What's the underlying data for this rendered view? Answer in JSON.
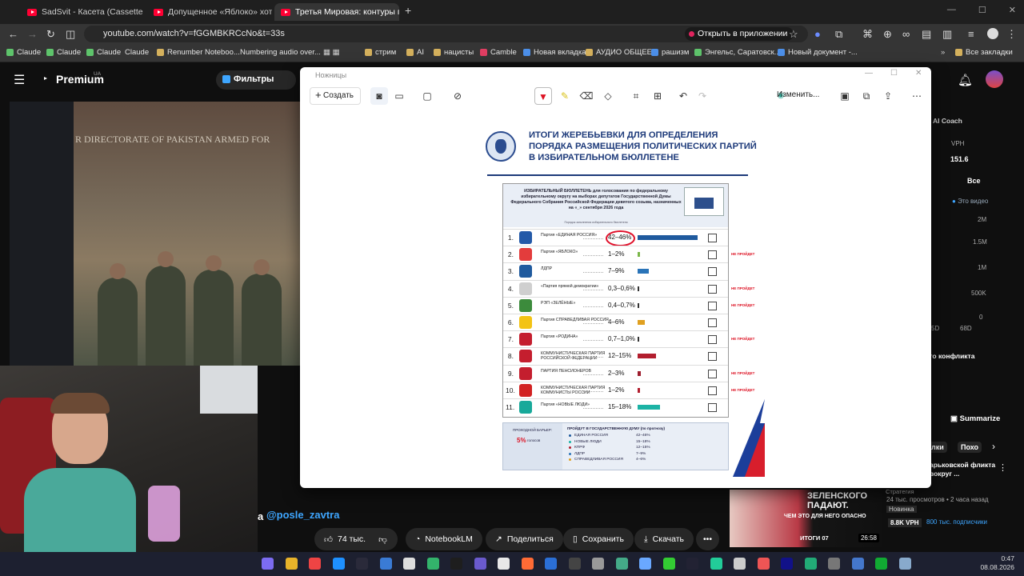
{
  "browser": {
    "tabs": [
      {
        "title": "SadSvit - Касета (Cassette 2021"
      },
      {
        "title": "Допущенное «Яблоко» хотят"
      },
      {
        "title": "Третья Мировая: контуры гло"
      }
    ],
    "new_tab": "+",
    "url": "youtube.com/watch?v=fGGMBKRCcNo&t=33s",
    "open_in_app": "Открыть в приложении",
    "bookmarks": [
      "Claude",
      "Claude",
      "Claude",
      "Claude",
      "Renumber Noteboo...",
      "Numbering audio over...",
      "стрим",
      "AI",
      "нацисты",
      "Camble",
      "Новая вкладка",
      "АУДИО ОБЩЕЕ",
      "рашизм",
      "Энгельс, Саратовск...",
      "Новый документ -..."
    ],
    "all_bookmarks": "Все закладки"
  },
  "youtube": {
    "logo": "Premium",
    "logo_region": "UA",
    "filters_btn": "Фильтры",
    "video_overlay": "R DIRECTORATE OF PAKISTAN ARMED FOR",
    "channel": "@posle_zavtra",
    "likes": "74 тыс.",
    "notebooklm": "NotebookLM",
    "share": "Поделиться",
    "save": "Сохранить",
    "download": "Скачать",
    "more": "•••",
    "side": {
      "coach": "AI Coach",
      "vph_label": "VPH",
      "vph_value": "151.6",
      "all": "Все",
      "this_video": "Это видео",
      "y_ticks": [
        "2M",
        "1.5M",
        "1M",
        "500K",
        "0"
      ],
      "x_ticks": [
        "5D",
        "68D"
      ],
      "conflict": "го конфликта",
      "summarize": "Summarize",
      "chip1": "лки",
      "chip2": "Похо",
      "rec_title": "арьковской фликта вокруг ...",
      "rec_stats": "24 тыс. просмотров • 2 часа назад",
      "rec_badge": "Новинка",
      "rec_vph": "8.8K VPH",
      "rec_subs": "800 тыс. подписчики",
      "rec_channel": "Стратегия"
    },
    "thumb": {
      "t1": "ЗЕЛЕНСКОГО ПАДАЮТ.",
      "t2": "ЧЕМ ЭТО ДЛЯ НЕГО ОПАСНО",
      "t3": "ИТОГИ 07",
      "duration": "26:58"
    }
  },
  "snipping": {
    "title": "Ножницы",
    "create": "Создать",
    "edit": "Изменить..."
  },
  "document": {
    "title": "ИТОГИ ЖЕРЕБЬЕВКИ ДЛЯ ОПРЕДЕЛЕНИЯ ПОРЯДКА РАЗМЕЩЕНИЯ ПОЛИТИЧЕСКИХ ПАРТИЙ В ИЗБИРАТЕЛЬНОМ БЮЛЛЕТЕНЕ",
    "ballot_header": "ИЗБИРАТЕЛЬНЫЙ БЮЛЛЕТЕНЬ для голосования по федеральному избирательному округу на выборах депутатов Государственной Думы Федерального Собрания Российской Федерации девятого созыва, назначенных на «_» сентября 2026 года",
    "ballot_sub": "Порядок заполнения избирательного бюллетеня",
    "fail_label": "НЕ ПРОЙДЕТ",
    "parties": [
      {
        "n": "1.",
        "name": "Партия «ЕДИНАЯ РОССИЯ»",
        "value": "42–46%",
        "bar": 0.44,
        "color": "#1f5a9e",
        "logo": "#2359a8",
        "fail": false
      },
      {
        "n": "2.",
        "name": "Партия «ЯБЛОКО»",
        "value": "1–2%",
        "bar": 0.015,
        "color": "#7ab648",
        "logo": "#e33c3c",
        "fail": true
      },
      {
        "n": "3.",
        "name": "ЛДПР",
        "value": "7–9%",
        "bar": 0.08,
        "color": "#2a74b8",
        "logo": "#1f5a9e",
        "fail": false
      },
      {
        "n": "4.",
        "name": "«Партия прямой демократии»",
        "value": "0,3–0,6%",
        "bar": 0.005,
        "color": "#333333",
        "logo": "#cfcfcf",
        "fail": true
      },
      {
        "n": "5.",
        "name": "РЭП «ЗЕЛЁНЫЕ»",
        "value": "0,4–0,7%",
        "bar": 0.006,
        "color": "#333333",
        "logo": "#3c8b3c",
        "fail": true
      },
      {
        "n": "6.",
        "name": "Партия СПРАВЕДЛИВАЯ РОССИЯ",
        "value": "4–6%",
        "bar": 0.05,
        "color": "#e0a020",
        "logo": "#f3c314",
        "fail": false
      },
      {
        "n": "7.",
        "name": "Партия «РОДИНА»",
        "value": "0,7–1,0%",
        "bar": 0.008,
        "color": "#333333",
        "logo": "#c41e2e",
        "fail": true
      },
      {
        "n": "8.",
        "name": "КОММУНИСТИЧЕСКАЯ ПАРТИЯ РОССИЙСКОЙ ФЕДЕРАЦИИ",
        "value": "12–15%",
        "bar": 0.135,
        "color": "#b21e2e",
        "logo": "#c41e2e",
        "fail": false
      },
      {
        "n": "9.",
        "name": "ПАРТИЯ ПЕНСИОНЕРОВ",
        "value": "2–3%",
        "bar": 0.025,
        "color": "#9e1e2e",
        "logo": "#c41e2e",
        "fail": true
      },
      {
        "n": "10.",
        "name": "КОММУНИСТИЧЕСКАЯ ПАРТИЯ КОММУНИСТЫ РОССИИ",
        "value": "1–2%",
        "bar": 0.015,
        "color": "#b21e2e",
        "logo": "#d22222",
        "fail": true
      },
      {
        "n": "11.",
        "name": "Партия «НОВЫЕ ЛЮДИ»",
        "value": "15–18%",
        "bar": 0.165,
        "color": "#1cb3a5",
        "logo": "#18a99a",
        "fail": false
      }
    ],
    "barrier_label": "ПРОХОДНОЙ БАРЬЕР:",
    "barrier_value": "5%",
    "barrier_unit": "голосов",
    "pass_head": "ПРОЙДУТ В ГОСУДАРСТВЕННУЮ ДУМУ (по прогнозу)",
    "pass": [
      {
        "name": "ЕДИНАЯ РОССИЯ",
        "value": "42–46%",
        "color": "#1f5a9e"
      },
      {
        "name": "НОВЫЕ ЛЮДИ",
        "value": "15–18%",
        "color": "#1cb3a5"
      },
      {
        "name": "КПРФ",
        "value": "12–15%",
        "color": "#b21e2e"
      },
      {
        "name": "ЛДПР",
        "value": "7–9%",
        "color": "#2a74b8"
      },
      {
        "name": "СПРАВЕДЛИВАЯ РОССИЯ",
        "value": "4–6%",
        "color": "#e0a020"
      }
    ]
  },
  "taskbar": {
    "time": "0:47",
    "date": "08.08.2026"
  }
}
